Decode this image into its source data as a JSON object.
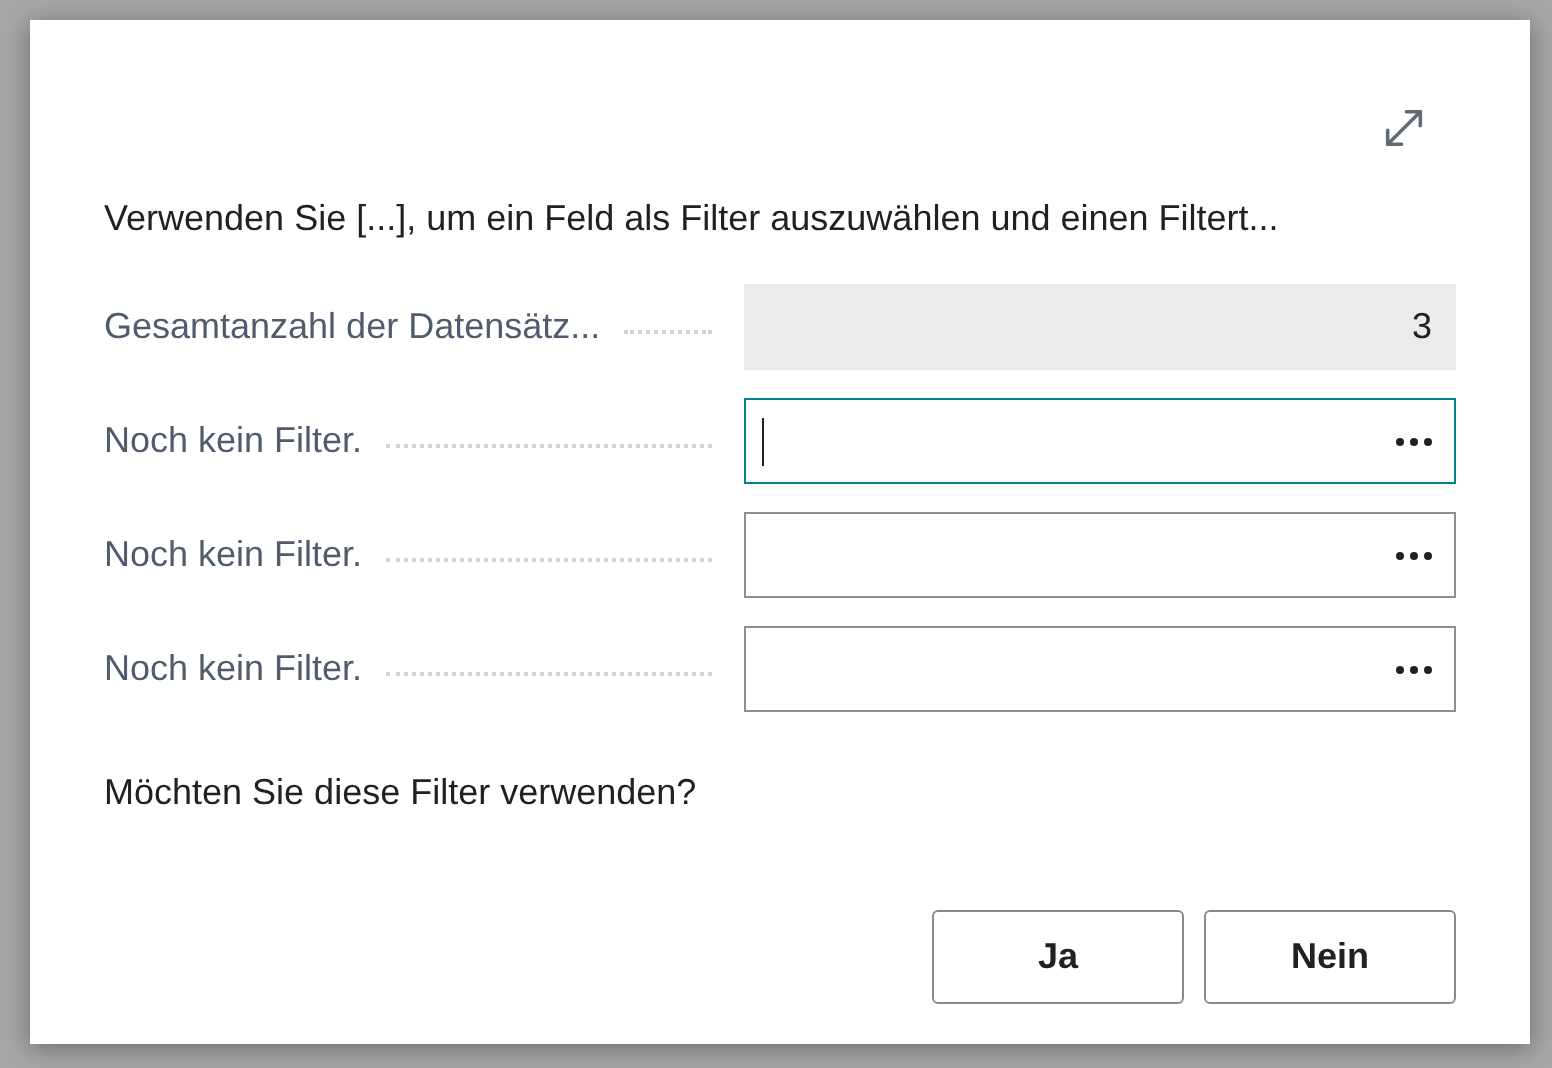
{
  "instruction": "Verwenden Sie [...], um ein Feld als Filter auszuwählen und einen Filtert...",
  "fields": [
    {
      "kind": "readonly",
      "label": "Gesamtanzahl der Datensätz...",
      "value": "3"
    },
    {
      "kind": "filter",
      "label": "Noch kein Filter.",
      "focused": true
    },
    {
      "kind": "filter",
      "label": "Noch kein Filter.",
      "focused": false
    },
    {
      "kind": "filter",
      "label": "Noch kein Filter.",
      "focused": false
    }
  ],
  "question": "Möchten Sie diese Filter verwenden?",
  "buttons": [
    "Ja",
    "Nein"
  ]
}
